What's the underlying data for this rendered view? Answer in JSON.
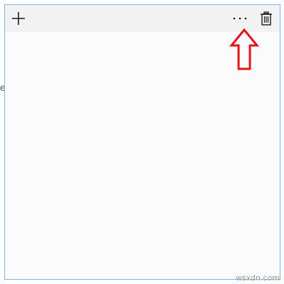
{
  "toolbar": {
    "add_icon": "plus-icon",
    "more_icon": "ellipsis-icon",
    "delete_icon": "trash-icon"
  },
  "note": {
    "content": ""
  },
  "background_fragment": "e",
  "annotation": {
    "type": "arrow-up",
    "color": "#e2141b"
  },
  "watermark": "wsxdn.com",
  "colors": {
    "window_border": "#7eb4ea",
    "toolbar_bg": "#f2f2f2",
    "note_bg": "#fbfbfb"
  }
}
